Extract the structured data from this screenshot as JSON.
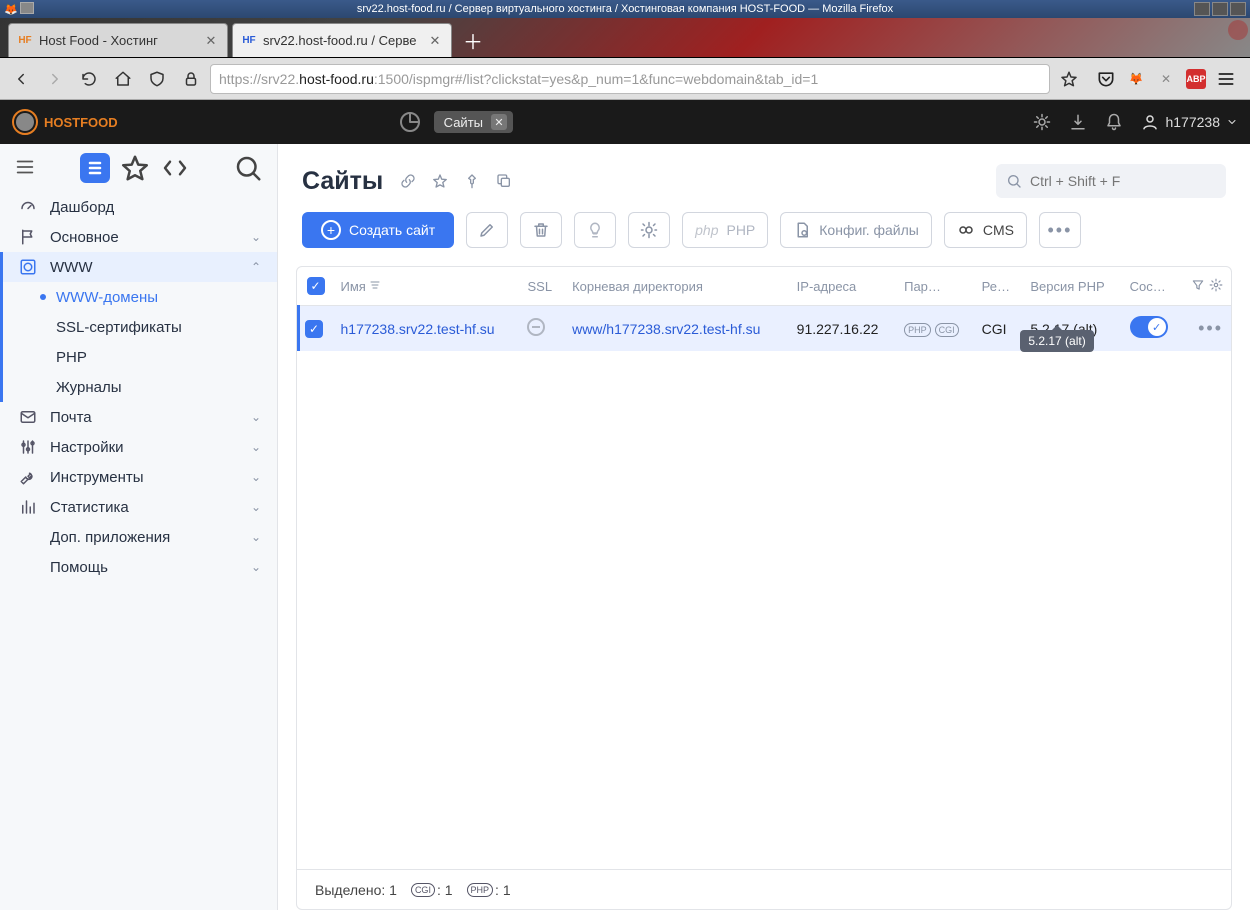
{
  "os": {
    "title": "srv22.host-food.ru / Сервер виртуального хостинга / Хостинговая компания HOST-FOOD — Mozilla Firefox"
  },
  "browser_tabs": [
    {
      "label": "Host Food - Хостинг"
    },
    {
      "label": "srv22.host-food.ru / Серве"
    }
  ],
  "url": {
    "proto": "https://srv22.",
    "host": "host-food.ru",
    "tail": ":1500/ispmgr#/list?clickstat=yes&p_num=1&func=webdomain&tab_id=1"
  },
  "logo_text": "HOSTFOOD",
  "app_tab": {
    "label": "Сайты"
  },
  "topuser": "h177238",
  "sidebar": {
    "dashboard": "Дашборд",
    "main": "Основное",
    "www": "WWW",
    "www_sub": {
      "domains": "WWW-домены",
      "ssl": "SSL-сертификаты",
      "php": "PHP",
      "logs": "Журналы"
    },
    "mail": "Почта",
    "settings": "Настройки",
    "tools": "Инструменты",
    "stats": "Статистика",
    "addons": "Доп. приложения",
    "help": "Помощь"
  },
  "page": {
    "title": "Сайты",
    "search_placeholder": "Ctrl + Shift + F"
  },
  "toolbar": {
    "create": "Создать сайт",
    "php": "PHP",
    "config": "Конфиг. файлы",
    "cms": "CMS"
  },
  "table": {
    "headers": {
      "name": "Имя",
      "ssl": "SSL",
      "root": "Корневая директория",
      "ip": "IP-адреса",
      "params": "Пар…",
      "mode": "Ре…",
      "php": "Версия PHP",
      "state": "Сос…"
    },
    "row": {
      "name": "h177238.srv22.test-hf.su",
      "root": "www/h177238.srv22.test-hf.su",
      "ip": "91.227.16.22",
      "mode": "CGI",
      "php": "5.2.17 (alt)",
      "tooltip": "5.2.17 (alt)"
    }
  },
  "footer": {
    "selected_label": "Выделено: 1",
    "cgi_count": ": 1",
    "php_count": ": 1"
  }
}
